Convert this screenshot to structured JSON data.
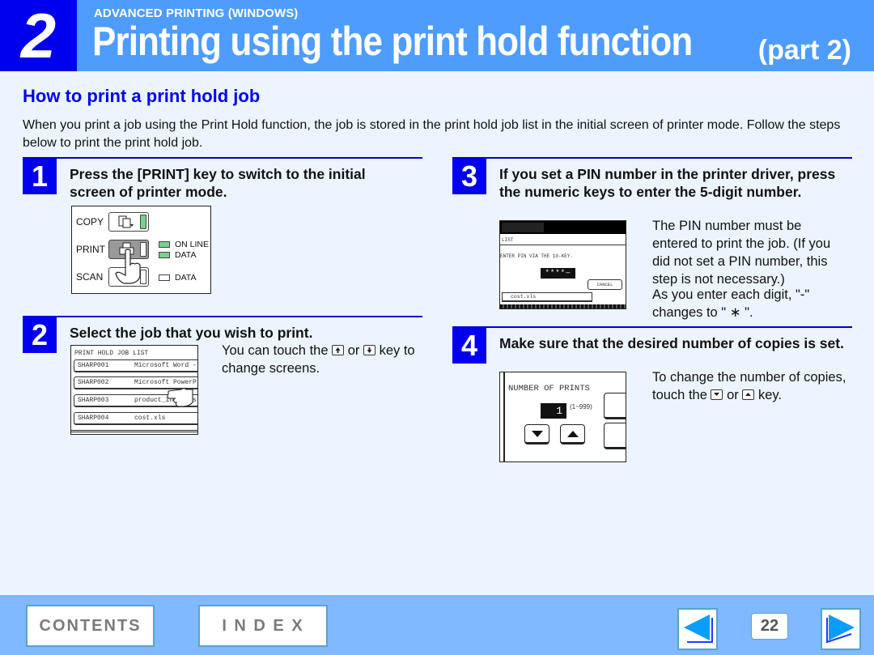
{
  "header": {
    "chapter_number": "2",
    "chapter_label": "ADVANCED PRINTING (WINDOWS)",
    "title": "Printing using the print hold function",
    "part": "(part 2)",
    "colors": {
      "band": "#4f9cff",
      "chapter_box": "#0000ee"
    }
  },
  "section": {
    "title": "How to print a print hold job",
    "intro": "When you print a job using the Print Hold function, the job is stored in the print hold job list in the initial screen of printer mode. Follow the steps below to print the print hold job."
  },
  "steps": [
    {
      "number": "1",
      "title": "Press the [PRINT] key to switch to the initial screen of printer mode.",
      "panel": {
        "keys": [
          "COPY",
          "PRINT",
          "SCAN"
        ],
        "lamps": [
          {
            "label": "ON LINE",
            "state": "on"
          },
          {
            "label": "DATA",
            "state": "on"
          },
          {
            "label": "DATA",
            "state": "off"
          }
        ]
      }
    },
    {
      "number": "2",
      "title": "Select the job that you wish to print.",
      "text_before": "You can touch the",
      "text_or": "or",
      "text_after": "key to change screens.",
      "screen": {
        "heading": "PRINT HOLD JOB LIST",
        "jobs": [
          {
            "id": "SHARP001",
            "name": "Microsoft Word -"
          },
          {
            "id": "SHARP002",
            "name": "Microsoft PowerP"
          },
          {
            "id": "SHARP003",
            "name": "product_info.xls"
          },
          {
            "id": "SHARP004",
            "name": "cost.xls"
          }
        ]
      }
    },
    {
      "number": "3",
      "title": "If you set a PIN number in the printer driver, press the numeric keys to enter the 5-digit number.",
      "text1": "The PIN number must be entered to print the job. (If you did not set a PIN number, this step is not necessary.)",
      "text2": "As you enter each digit, \"-\" changes to \" ∗ \".",
      "screen": {
        "list_label": "LIST",
        "prompt": "ENTER PIN VIA THE 10-KEY.",
        "pin_value": "****—",
        "cancel_label": "CANCEL",
        "file": "cost.xls"
      }
    },
    {
      "number": "4",
      "title": "Make sure that the desired number of copies is set.",
      "text_before": "To change the number of copies, touch the",
      "text_or": "or",
      "text_after": "key.",
      "screen": {
        "heading": "NUMBER OF PRINTS",
        "value": "1",
        "range": "(1~999)"
      }
    }
  ],
  "footer": {
    "contents_label": "CONTENTS",
    "index_label": "I N D E X",
    "page_number": "22",
    "prev_icon": "left-arrow",
    "next_icon": "right-arrow"
  }
}
